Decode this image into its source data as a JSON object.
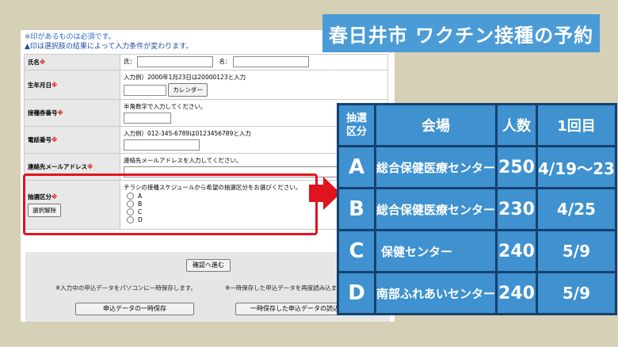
{
  "notes": {
    "required": "※印があるものは必須です。",
    "conditional": "▲印は選択肢の結果によって入力条件が変わります。"
  },
  "form": {
    "name": {
      "label": "氏名",
      "mark": "※",
      "sei_label": "氏：",
      "mei_label": "名：",
      "sei_value": "",
      "mei_value": ""
    },
    "birth": {
      "label": "生年月日",
      "mark": "※",
      "hint": "入力例）2000年1月23日は20000123と入力",
      "value": "",
      "calendar_button": "カレンダー"
    },
    "ticket": {
      "label": "接種券番号",
      "mark": "※",
      "hint": "半角数字で入力してください。",
      "value": ""
    },
    "phone": {
      "label": "電話番号",
      "mark": "※",
      "hint": "入力例）012-345-6789は0123456789と入力",
      "value": ""
    },
    "email": {
      "label": "連絡先メールアドレス",
      "mark": "※",
      "hint": "連絡先メールアドレスを入力してください。",
      "value": ""
    },
    "lottery": {
      "label": "抽選区分",
      "mark": "※",
      "clear_button": "選択解除",
      "hint": "チラシの接種スケジュールから希望の抽選区分をお選びください。",
      "options": [
        "A",
        "B",
        "C",
        "D"
      ]
    }
  },
  "bottom": {
    "confirm_button": "確認へ進む",
    "save_note": "※入力中の申込データをパソコンに一時保存します。",
    "load_note": "※一時保存した申込データを再度読み込ま",
    "save_button": "申込データの一時保存",
    "load_button": "一時保存した申込データの読込み"
  },
  "banner": {
    "title": "春日井市 ワクチン接種の予約"
  },
  "schedule": {
    "headers": {
      "category_line1": "抽選",
      "category_line2": "区分",
      "venue": "会場",
      "count": "人数",
      "first_dose": "1回目"
    },
    "rows": [
      {
        "category": "A",
        "venue": "総合保健医療センター",
        "count": "250",
        "date": "4/19～23"
      },
      {
        "category": "B",
        "venue": "総合保健医療センター",
        "count": "230",
        "date": "4/25"
      },
      {
        "category": "C",
        "venue": "保健センター",
        "count": "240",
        "date": "5/9"
      },
      {
        "category": "D",
        "venue": "南部ふれあいセンター",
        "count": "240",
        "date": "5/9"
      }
    ]
  },
  "colors": {
    "banner": "#4b9bd6",
    "table_cell": "#3f91cf",
    "table_border": "#16406e",
    "highlight": "#e0141e",
    "background": "#d6d0b6"
  }
}
